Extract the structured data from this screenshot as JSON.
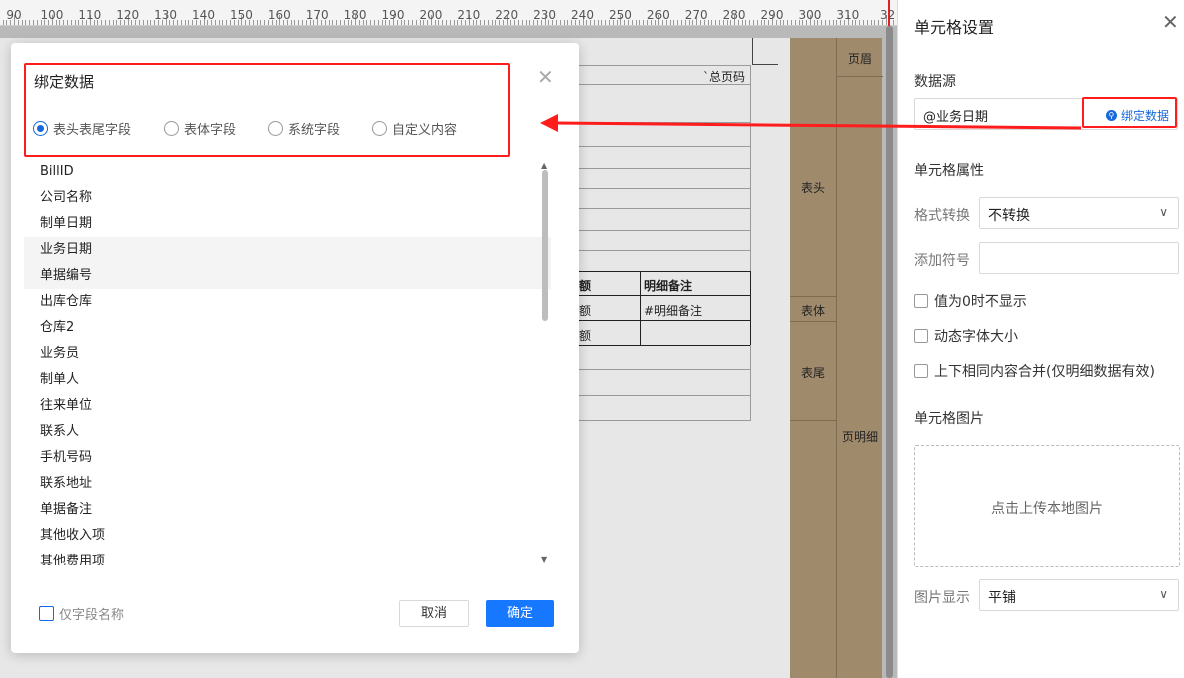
{
  "ruler": {
    "labels": [
      "90",
      "100",
      "110",
      "120",
      "130",
      "140",
      "150",
      "160",
      "170",
      "180",
      "190",
      "200",
      "210",
      "220",
      "230",
      "240",
      "250",
      "260",
      "270",
      "280",
      "290",
      "300",
      "310",
      "32"
    ]
  },
  "report": {
    "total_page_text": "`总页码",
    "header_amount": "额",
    "header_detail_note": "明细备注",
    "row_amount": "额",
    "row_detail_note": "#明细备注",
    "row2_amount": "额",
    "band_page_header": "页眉",
    "band_table_header": "表头",
    "band_table_body": "表体",
    "band_table_footer": "表尾",
    "band_page_detail": "页明细"
  },
  "panel": {
    "title": "单元格设置",
    "close_icon": "close-icon",
    "data_source_label": "数据源",
    "data_source_value": "@业务日期",
    "bind_data_label": "绑定数据",
    "cell_props_label": "单元格属性",
    "format_label": "格式转换",
    "format_value": "不转换",
    "add_symbol_label": "添加符号",
    "add_symbol_value": "",
    "hide_zero_label": "值为0时不显示",
    "dynamic_font_label": "动态字体大小",
    "merge_label": "上下相同内容合并(仅明细数据有效)",
    "image_label": "单元格图片",
    "upload_text": "点击上传本地图片",
    "image_display_label": "图片显示",
    "image_display_value": "平铺"
  },
  "dialog": {
    "title": "绑定数据",
    "radios": [
      {
        "label": "表头表尾字段",
        "checked": true
      },
      {
        "label": "表体字段",
        "checked": false
      },
      {
        "label": "系统字段",
        "checked": false
      },
      {
        "label": "自定义内容",
        "checked": false
      }
    ],
    "fields": [
      "BillID",
      "公司名称",
      "制单日期",
      "业务日期",
      "单据编号",
      "出库仓库",
      "仓库2",
      "业务员",
      "制单人",
      "往来单位",
      "联系人",
      "手机号码",
      "联系地址",
      "单据备注",
      "其他收入项",
      "其他费用项"
    ],
    "highlighted_fields": [
      "业务日期",
      "单据编号"
    ],
    "only_field_name_label": "仅字段名称",
    "cancel_label": "取消",
    "ok_label": "确定"
  },
  "colors": {
    "accent": "#1677ff",
    "highlight": "#ff1c1c",
    "band": "#a08a6c"
  }
}
